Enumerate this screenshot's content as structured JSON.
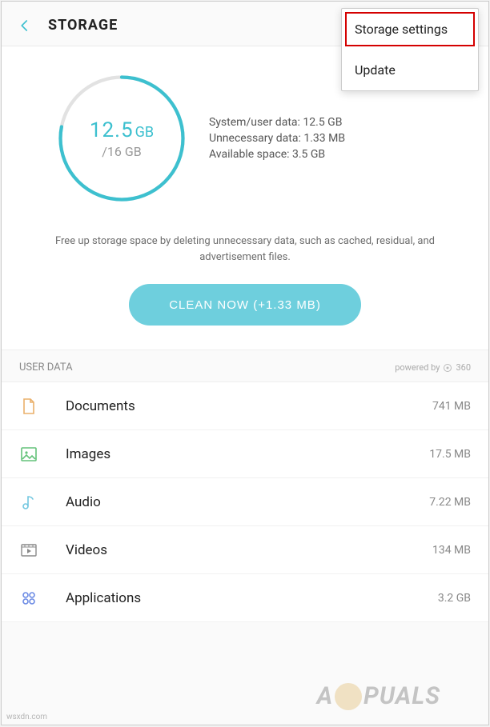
{
  "header": {
    "title": "STORAGE"
  },
  "menu": {
    "items": [
      {
        "label": "Storage settings"
      },
      {
        "label": "Update"
      }
    ]
  },
  "summary": {
    "used_value": "12.5",
    "used_unit": "GB",
    "total": "/16 GB",
    "used_fraction": 0.78,
    "stats": {
      "system_label": "System/user data:",
      "system_value": "12.5 GB",
      "unnecessary_label": "Unnecessary data:",
      "unnecessary_value": "1.33 MB",
      "available_label": "Available space:",
      "available_value": "3.5 GB"
    }
  },
  "tip": "Free up storage space by deleting unnecessary data, such as cached, residual, and advertisement files.",
  "clean_button": "CLEAN NOW (+1.33 MB)",
  "section": {
    "title": "USER DATA",
    "powered_by": "powered by",
    "powered_brand": "360"
  },
  "list": [
    {
      "icon": "document-icon",
      "label": "Documents",
      "size": "741 MB",
      "color": "#eab06b"
    },
    {
      "icon": "image-icon",
      "label": "Images",
      "size": "17.5 MB",
      "color": "#64c27a"
    },
    {
      "icon": "audio-icon",
      "label": "Audio",
      "size": "7.22 MB",
      "color": "#72c7e0"
    },
    {
      "icon": "video-icon",
      "label": "Videos",
      "size": "134 MB",
      "color": "#8a8a8a"
    },
    {
      "icon": "apps-icon",
      "label": "Applications",
      "size": "3.2 GB",
      "color": "#6b8ae4"
    }
  ],
  "watermark": {
    "left": "A",
    "right": "PUALS"
  },
  "tiny_mark": "wsxdn.com"
}
